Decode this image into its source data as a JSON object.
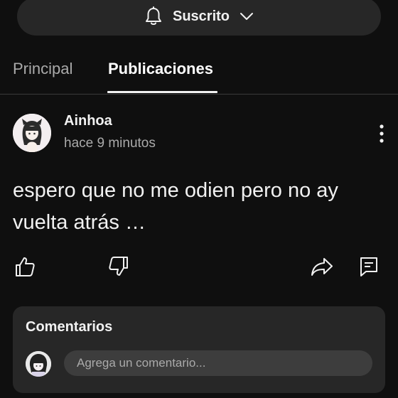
{
  "subscribe": {
    "label": "Suscrito",
    "bell_icon": "bell-icon",
    "chevron_icon": "chevron-down-icon"
  },
  "tabs": [
    {
      "label": "Principal",
      "active": false
    },
    {
      "label": "Publicaciones",
      "active": true
    }
  ],
  "post": {
    "author": "Ainhoa",
    "time": "hace 9 minutos",
    "text": "espero que no me odien pero no ay vuelta atrás …",
    "icons": [
      "thumbs-up-icon",
      "thumbs-down-icon",
      "share-icon",
      "comment-icon",
      "more-vert-icon"
    ]
  },
  "comments": {
    "title": "Comentarios",
    "placeholder": "Agrega un comentario..."
  },
  "colors": {
    "background": "#0f0f0f",
    "surface": "#272727",
    "input": "#3d3d3d",
    "text": "#f1f1f1",
    "muted": "#aaaaaa"
  }
}
